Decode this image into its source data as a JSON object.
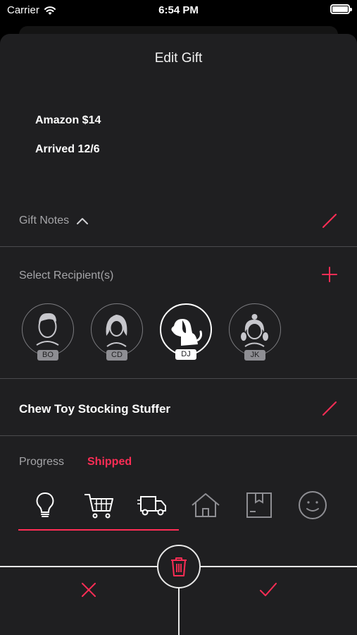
{
  "status_bar": {
    "carrier": "Carrier",
    "time": "6:54 PM"
  },
  "sheet": {
    "title": "Edit Gift"
  },
  "gift_info": {
    "line1": "Amazon $14",
    "line2": "Arrived 12/6"
  },
  "notes": {
    "label": "Gift Notes",
    "expand_icon": "chevron-up-icon",
    "edit_icon": "pencil-icon"
  },
  "recipients": {
    "label": "Select Recipient(s)",
    "add_icon": "plus-icon",
    "items": [
      {
        "initials": "BO",
        "icon": "man-avatar-icon",
        "selected": false
      },
      {
        "initials": "CD",
        "icon": "woman-avatar-icon",
        "selected": false
      },
      {
        "initials": "DJ",
        "icon": "dog-avatar-icon",
        "selected": true
      },
      {
        "initials": "JK",
        "icon": "girl-avatar-icon",
        "selected": false
      }
    ]
  },
  "gift": {
    "name": "Chew Toy Stocking Stuffer",
    "edit_icon": "pencil-icon"
  },
  "progress": {
    "label": "Progress",
    "status": "Shipped",
    "stages": [
      "idea",
      "purchased",
      "shipped",
      "delivered",
      "wrapped",
      "given"
    ],
    "current_stage": 3,
    "total_stages": 6
  },
  "actions": {
    "delete_icon": "trash-icon",
    "cancel_icon": "x-icon",
    "confirm_icon": "checkmark-icon"
  },
  "colors": {
    "accent": "#ff2d55",
    "sheet_background": "#1f1f21",
    "muted_text": "#a5a5a8"
  }
}
